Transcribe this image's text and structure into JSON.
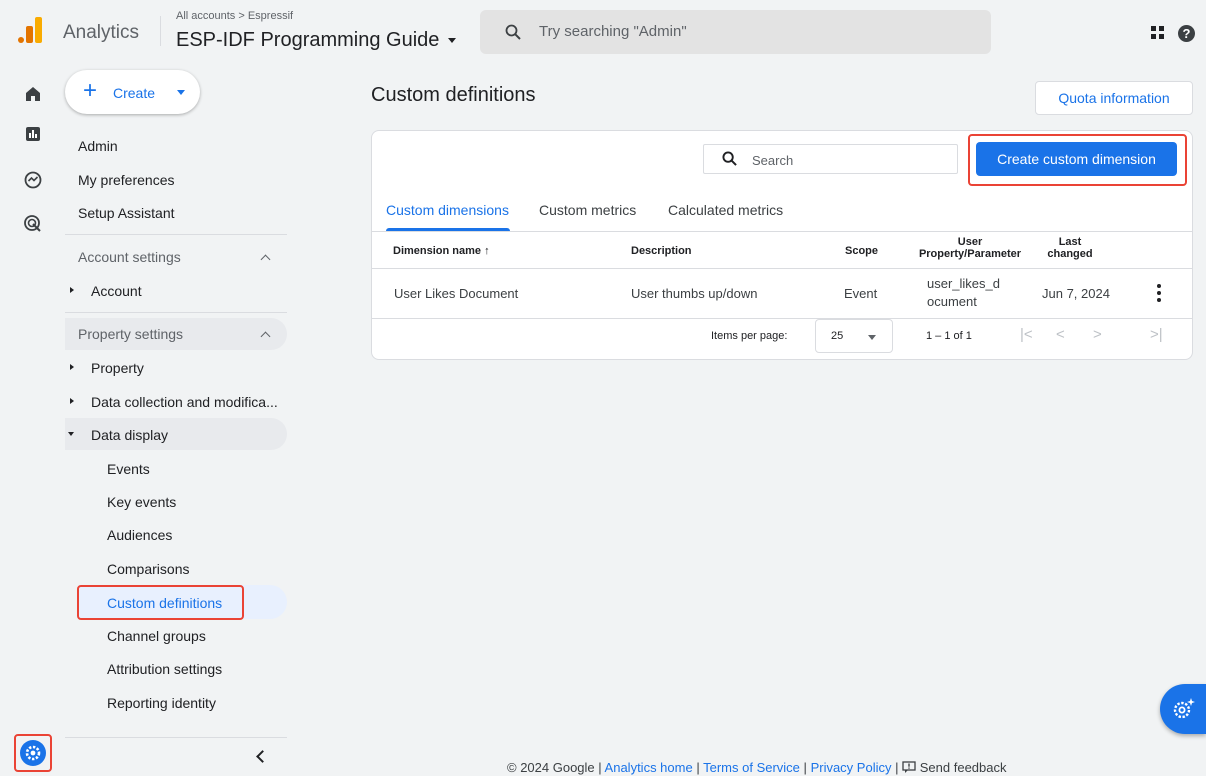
{
  "topbar": {
    "product_name": "Analytics",
    "breadcrumb": "All accounts > Espressif",
    "property_name": "ESP-IDF Programming Guide",
    "search_placeholder": "Try searching \"Admin\"",
    "help_glyph": "?"
  },
  "rail": {
    "icons": [
      "home-icon",
      "reports-icon",
      "explore-icon",
      "advertising-icon"
    ],
    "admin_icon": "gear-icon"
  },
  "sidebar": {
    "create_label": "Create",
    "links": [
      "Admin",
      "My preferences",
      "Setup Assistant"
    ],
    "account_settings": "Account settings",
    "account_item": "Account",
    "property_settings": "Property settings",
    "property_item": "Property",
    "data_collection_item": "Data collection and modifica...",
    "data_display_item": "Data display",
    "data_display_children": [
      "Events",
      "Key events",
      "Audiences",
      "Comparisons",
      "Custom definitions",
      "Channel groups",
      "Attribution settings",
      "Reporting identity"
    ],
    "active_item": "Custom definitions"
  },
  "main": {
    "title": "Custom definitions",
    "quota_button": "Quota information",
    "search_placeholder": "Search",
    "create_button": "Create custom dimension",
    "tabs": [
      "Custom dimensions",
      "Custom metrics",
      "Calculated metrics"
    ],
    "active_tab": "Custom dimensions",
    "columns": {
      "name": "Dimension name ↑",
      "description": "Description",
      "scope": "Scope",
      "user_prop_1": "User",
      "user_prop_2": "Property/Parameter",
      "last_changed_1": "Last",
      "last_changed_2": "changed"
    },
    "rows": [
      {
        "name": "User Likes Document",
        "description": "User thumbs up/down",
        "scope": "Event",
        "param_1": "user_likes_d",
        "param_2": "ocument",
        "last_changed": "Jun 7, 2024"
      }
    ],
    "pagination": {
      "items_per_page_label": "Items per page:",
      "items_per_page": "25",
      "range": "1 – 1 of 1",
      "first": "|<",
      "prev": "<",
      "next": ">",
      "last": ">|"
    }
  },
  "footer": {
    "copyright": "© 2024 Google |",
    "analytics_home": "Analytics home",
    "sep1": "|",
    "terms": "Terms of Service",
    "sep2": "|",
    "privacy": "Privacy Policy",
    "sep3": "|",
    "feedback": "Send feedback"
  },
  "colors": {
    "accent": "#1a73e8",
    "highlight": "#ea4335",
    "background": "#f1f3f4"
  }
}
